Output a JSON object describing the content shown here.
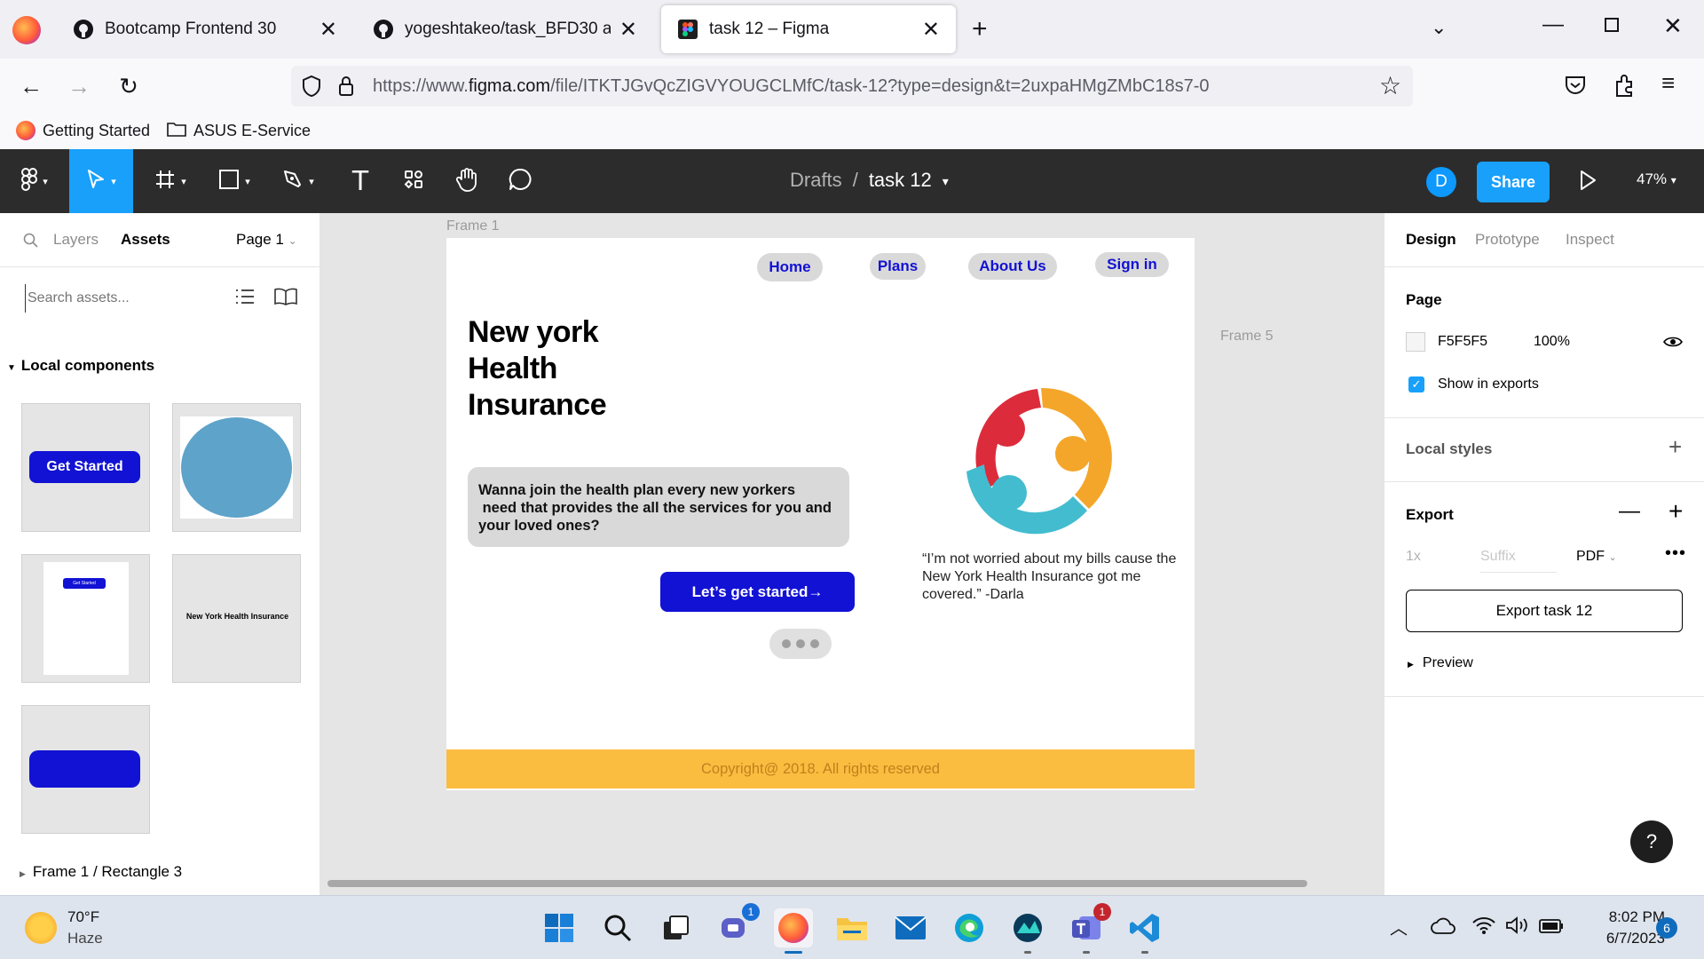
{
  "browser": {
    "tabs": [
      {
        "label": "Bootcamp Frontend 30",
        "icon": "github-icon"
      },
      {
        "label": "yogeshtakeo/task_BFD30 at dev",
        "icon": "github-icon"
      },
      {
        "label": "task 12 – Figma",
        "icon": "figma-icon"
      }
    ],
    "url_prefix": "https://www.",
    "url_domain": "figma.com",
    "url_rest": "/file/ITKTJGvQcZIGVYOUGCLMfC/task-12?type=design&t=2uxpaHMgZMbC18s7-0",
    "bookmarks": [
      "Getting Started",
      "ASUS E-Service"
    ]
  },
  "figma": {
    "breadcrumb_parent": "Drafts",
    "breadcrumb_sep": "/",
    "file_name": "task 12",
    "avatar_initial": "D",
    "share_label": "Share",
    "zoom": "47%"
  },
  "left_panel": {
    "tab_layers": "Layers",
    "tab_assets": "Assets",
    "page_selector": "Page 1",
    "search_placeholder": "Search assets...",
    "section_title": "Local components",
    "comp_get_started": "Get Started",
    "comp_small_btn": "Get Started",
    "comp_title_text": "New York Health Insurance",
    "footer_path": "Frame 1 / Rectangle 3"
  },
  "canvas": {
    "frame1_label": "Frame 1",
    "frame5_label": "Frame 5",
    "nav": [
      "Home",
      "Plans",
      "About Us",
      "Sign in"
    ],
    "heading_lines": [
      "New york",
      "Health",
      "Insurance"
    ],
    "pitch": "Wanna join the health plan every new yorkers\n need that provides the all the services for you and your loved ones?",
    "cta": "Let’s get started→",
    "quote": "“I’m not worried about my bills cause the New York Health Insurance got me covered.” -Darla",
    "footer": "Copyright@ 2018. All rights reserved"
  },
  "right_panel": {
    "tabs": [
      "Design",
      "Prototype",
      "Inspect"
    ],
    "page_title": "Page",
    "page_color": "F5F5F5",
    "page_opacity": "100%",
    "show_exports": "Show in exports",
    "local_styles": "Local styles",
    "export_title": "Export",
    "export_scale": "1x",
    "export_suffix": "Suffix",
    "export_format": "PDF",
    "export_button": "Export task 12",
    "preview": "Preview"
  },
  "taskbar": {
    "weather_temp": "70°F",
    "weather_desc": "Haze",
    "time": "8:02 PM",
    "date": "6/7/2023",
    "notif_count": "6",
    "teams_badge": "1",
    "meet_badge": "1"
  },
  "colors": {
    "figma_blue": "#18a0fb",
    "cta_blue": "#1212d4",
    "footer_yellow": "#fbbd40",
    "toolbar_dark": "#2c2c2c"
  }
}
